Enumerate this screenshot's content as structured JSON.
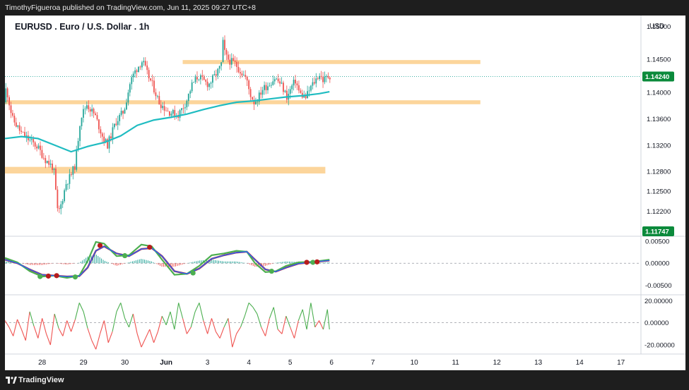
{
  "header": {
    "publish_line": "TimothyFigueroa published on TradingView.com, Jun 11, 2025 09:27 UTC+8"
  },
  "footer": {
    "brand": "TradingView"
  },
  "colors": {
    "up": "#26a69a",
    "down": "#ef5350",
    "ma": "#1fbcc1",
    "zone": "#fcd59b",
    "macd_fast": "#4caf50",
    "macd_slow": "#2962ff",
    "macd_slow_dark": "#b71c1c",
    "osc_up": "#4caf50",
    "osc_down": "#ef5350",
    "label_bg": "#0b8a3b"
  },
  "chart_data": [
    {
      "type": "candlestick",
      "title": "EURUSD . Euro / U.S. Dollar . 1h",
      "currency": "USD",
      "ylim": [
        1.1185,
        1.1508
      ],
      "y_ticks": [
        "1.15000",
        "1.14500",
        "1.14000",
        "1.13600",
        "1.13200",
        "1.12800",
        "1.12500",
        "1.12200"
      ],
      "last_price": "1.14240",
      "extra_price_label": "1.11747",
      "x_tick_labels": [
        "28",
        "29",
        "30",
        "Jun",
        "3",
        "4",
        "5",
        "6",
        "7",
        "10",
        "11",
        "12",
        "13",
        "14",
        "17"
      ],
      "resistance_zone": [
        1.1443,
        1.1449
      ],
      "support_zone": [
        1.1382,
        1.1388
      ],
      "low_zone": [
        1.1277,
        1.1287
      ],
      "price_path": [
        [
          0,
          1.1385
        ],
        [
          0.05,
          1.1408
        ],
        [
          0.2,
          1.136
        ],
        [
          0.42,
          1.1338
        ],
        [
          0.6,
          1.1328
        ],
        [
          0.8,
          1.1318
        ],
        [
          1.0,
          1.1298
        ],
        [
          1.2,
          1.1285
        ],
        [
          1.3,
          1.1215
        ],
        [
          1.38,
          1.123
        ],
        [
          1.5,
          1.1262
        ],
        [
          1.62,
          1.1275
        ],
        [
          1.72,
          1.129
        ],
        [
          1.85,
          1.1362
        ],
        [
          2.0,
          1.1382
        ],
        [
          2.2,
          1.1365
        ],
        [
          2.4,
          1.133
        ],
        [
          2.5,
          1.132
        ],
        [
          2.7,
          1.1355
        ],
        [
          2.9,
          1.1372
        ],
        [
          3.05,
          1.1415
        ],
        [
          3.15,
          1.143
        ],
        [
          3.25,
          1.144
        ],
        [
          3.35,
          1.1448
        ],
        [
          3.45,
          1.143
        ],
        [
          3.6,
          1.141
        ],
        [
          3.75,
          1.1385
        ],
        [
          3.95,
          1.1372
        ],
        [
          4.2,
          1.1365
        ],
        [
          4.4,
          1.1385
        ],
        [
          4.55,
          1.1412
        ],
        [
          4.7,
          1.1425
        ],
        [
          4.8,
          1.1418
        ],
        [
          4.95,
          1.1412
        ],
        [
          5.1,
          1.1425
        ],
        [
          5.25,
          1.144
        ],
        [
          5.3,
          1.1478
        ],
        [
          5.35,
          1.1455
        ],
        [
          5.45,
          1.1448
        ],
        [
          5.6,
          1.1443
        ],
        [
          5.72,
          1.1432
        ],
        [
          5.85,
          1.1422
        ],
        [
          5.95,
          1.1398
        ],
        [
          6.05,
          1.1385
        ],
        [
          6.15,
          1.1392
        ],
        [
          6.25,
          1.1405
        ],
        [
          6.4,
          1.1412
        ],
        [
          6.55,
          1.1422
        ],
        [
          6.7,
          1.1412
        ],
        [
          6.85,
          1.1392
        ],
        [
          6.95,
          1.1408
        ],
        [
          7.05,
          1.1418
        ],
        [
          7.15,
          1.1398
        ],
        [
          7.3,
          1.1392
        ],
        [
          7.42,
          1.1408
        ],
        [
          7.55,
          1.142
        ],
        [
          7.62,
          1.1428
        ],
        [
          7.72,
          1.1418
        ],
        [
          7.85,
          1.1425
        ]
      ],
      "ma_path": [
        [
          0,
          1.133
        ],
        [
          0.4,
          1.1333
        ],
        [
          0.8,
          1.133
        ],
        [
          1.2,
          1.132
        ],
        [
          1.6,
          1.131
        ],
        [
          2.0,
          1.1318
        ],
        [
          2.4,
          1.1324
        ],
        [
          2.8,
          1.1334
        ],
        [
          3.2,
          1.135
        ],
        [
          3.6,
          1.1358
        ],
        [
          4.0,
          1.1362
        ],
        [
          4.4,
          1.1367
        ],
        [
          4.8,
          1.1374
        ],
        [
          5.2,
          1.138
        ],
        [
          5.6,
          1.1385
        ],
        [
          6.0,
          1.1387
        ],
        [
          6.4,
          1.139
        ],
        [
          6.8,
          1.1393
        ],
        [
          7.2,
          1.1395
        ],
        [
          7.6,
          1.1398
        ],
        [
          7.85,
          1.1401
        ]
      ]
    },
    {
      "type": "macd",
      "y_ticks": [
        "0.00500",
        "0.00000",
        "-0.00500"
      ],
      "ylim": [
        -0.0068,
        0.0056
      ],
      "fast_path": [
        [
          0,
          0.0012
        ],
        [
          0.3,
          0.0002
        ],
        [
          0.6,
          -0.0018
        ],
        [
          0.9,
          -0.003
        ],
        [
          1.2,
          -0.0028
        ],
        [
          1.5,
          -0.0033
        ],
        [
          1.8,
          -0.0028
        ],
        [
          2.0,
          0.0005
        ],
        [
          2.2,
          0.0048
        ],
        [
          2.4,
          0.0044
        ],
        [
          2.7,
          0.0016
        ],
        [
          3.0,
          0.0018
        ],
        [
          3.3,
          0.0042
        ],
        [
          3.55,
          0.0038
        ],
        [
          3.8,
          0.0008
        ],
        [
          4.1,
          -0.0026
        ],
        [
          4.4,
          -0.0024
        ],
        [
          4.7,
          -0.0006
        ],
        [
          5.0,
          0.0018
        ],
        [
          5.3,
          0.0022
        ],
        [
          5.6,
          0.0028
        ],
        [
          5.85,
          0.0026
        ],
        [
          6.05,
          0.0
        ],
        [
          6.3,
          -0.002
        ],
        [
          6.55,
          -0.0018
        ],
        [
          6.8,
          -0.0006
        ],
        [
          7.1,
          0.0002
        ],
        [
          7.4,
          0.0003
        ],
        [
          7.6,
          0.0005
        ],
        [
          7.85,
          0.0008
        ]
      ],
      "slow_path": [
        [
          0,
          0.0008
        ],
        [
          0.3,
          0.0
        ],
        [
          0.6,
          -0.0014
        ],
        [
          0.9,
          -0.0026
        ],
        [
          1.2,
          -0.0028
        ],
        [
          1.5,
          -0.003
        ],
        [
          1.8,
          -0.0029
        ],
        [
          2.0,
          -0.001
        ],
        [
          2.2,
          0.0028
        ],
        [
          2.4,
          0.0038
        ],
        [
          2.7,
          0.0022
        ],
        [
          3.0,
          0.0016
        ],
        [
          3.3,
          0.0032
        ],
        [
          3.55,
          0.0034
        ],
        [
          3.8,
          0.0016
        ],
        [
          4.1,
          -0.0018
        ],
        [
          4.4,
          -0.0024
        ],
        [
          4.7,
          -0.0012
        ],
        [
          5.0,
          0.001
        ],
        [
          5.3,
          0.0018
        ],
        [
          5.6,
          0.0024
        ],
        [
          5.85,
          0.0026
        ],
        [
          6.05,
          0.0008
        ],
        [
          6.3,
          -0.0014
        ],
        [
          6.55,
          -0.0019
        ],
        [
          6.8,
          -0.001
        ],
        [
          7.1,
          -0.0001
        ],
        [
          7.4,
          0.0002
        ],
        [
          7.6,
          0.0004
        ],
        [
          7.85,
          0.0006
        ]
      ],
      "cross_dots": [
        {
          "x": 0.85,
          "y": -0.003,
          "c": "green"
        },
        {
          "x": 1.05,
          "y": -0.0029,
          "c": "red"
        },
        {
          "x": 1.25,
          "y": -0.0028,
          "c": "red"
        },
        {
          "x": 1.7,
          "y": -0.0031,
          "c": "green"
        },
        {
          "x": 2.3,
          "y": 0.004,
          "c": "red"
        },
        {
          "x": 2.9,
          "y": 0.0017,
          "c": "green"
        },
        {
          "x": 3.5,
          "y": 0.0036,
          "c": "red"
        },
        {
          "x": 4.55,
          "y": -0.0022,
          "c": "green"
        },
        {
          "x": 6.45,
          "y": -0.0018,
          "c": "green"
        },
        {
          "x": 7.3,
          "y": 0.0002,
          "c": "red"
        },
        {
          "x": 7.45,
          "y": 0.0002,
          "c": "green"
        },
        {
          "x": 7.55,
          "y": 0.0003,
          "c": "red"
        }
      ]
    },
    {
      "type": "oscillator",
      "y_ticks": [
        "20.00000",
        "0.00000",
        "-20.00000"
      ],
      "ylim": [
        -27,
        24
      ],
      "path": [
        [
          0,
          2
        ],
        [
          0.1,
          -4
        ],
        [
          0.2,
          -12
        ],
        [
          0.3,
          3
        ],
        [
          0.4,
          -6
        ],
        [
          0.5,
          -16
        ],
        [
          0.6,
          10
        ],
        [
          0.7,
          -3
        ],
        [
          0.8,
          -14
        ],
        [
          0.9,
          4
        ],
        [
          1.0,
          -10
        ],
        [
          1.1,
          -20
        ],
        [
          1.2,
          8
        ],
        [
          1.3,
          -5
        ],
        [
          1.4,
          -12
        ],
        [
          1.5,
          2
        ],
        [
          1.6,
          -8
        ],
        [
          1.7,
          3
        ],
        [
          1.8,
          18
        ],
        [
          1.9,
          10
        ],
        [
          2.0,
          -5
        ],
        [
          2.1,
          -16
        ],
        [
          2.2,
          -24
        ],
        [
          2.3,
          -10
        ],
        [
          2.4,
          2
        ],
        [
          2.5,
          -18
        ],
        [
          2.6,
          -8
        ],
        [
          2.7,
          10
        ],
        [
          2.8,
          18
        ],
        [
          2.9,
          4
        ],
        [
          3.0,
          -4
        ],
        [
          3.1,
          8
        ],
        [
          3.2,
          -10
        ],
        [
          3.3,
          -22
        ],
        [
          3.4,
          -14
        ],
        [
          3.5,
          -6
        ],
        [
          3.6,
          -18
        ],
        [
          3.7,
          -8
        ],
        [
          3.8,
          6
        ],
        [
          3.9,
          -2
        ],
        [
          4.0,
          10
        ],
        [
          4.1,
          -6
        ],
        [
          4.2,
          18
        ],
        [
          4.3,
          4
        ],
        [
          4.4,
          -10
        ],
        [
          4.5,
          -4
        ],
        [
          4.6,
          10
        ],
        [
          4.7,
          18
        ],
        [
          4.8,
          2
        ],
        [
          4.9,
          -10
        ],
        [
          5.0,
          4
        ],
        [
          5.1,
          -8
        ],
        [
          5.2,
          -14
        ],
        [
          5.3,
          -4
        ],
        [
          5.4,
          4
        ],
        [
          5.5,
          -22
        ],
        [
          5.6,
          -10
        ],
        [
          5.7,
          -4
        ],
        [
          5.8,
          6
        ],
        [
          5.9,
          18
        ],
        [
          6.0,
          14
        ],
        [
          6.1,
          8
        ],
        [
          6.2,
          -4
        ],
        [
          6.3,
          -12
        ],
        [
          6.4,
          4
        ],
        [
          6.5,
          14
        ],
        [
          6.6,
          -6
        ],
        [
          6.7,
          -10
        ],
        [
          6.8,
          6
        ],
        [
          6.9,
          -4
        ],
        [
          7.0,
          -14
        ],
        [
          7.1,
          2
        ],
        [
          7.2,
          12
        ],
        [
          7.3,
          -6
        ],
        [
          7.4,
          18
        ],
        [
          7.5,
          -4
        ],
        [
          7.6,
          2
        ],
        [
          7.7,
          -6
        ],
        [
          7.8,
          12
        ],
        [
          7.85,
          -6
        ]
      ]
    }
  ]
}
